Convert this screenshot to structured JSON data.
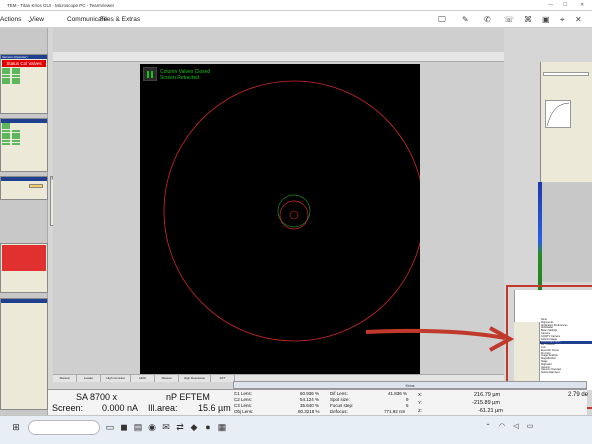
{
  "window": {
    "title": "TEM - Titan Krios GUI - Microscope PC - TeamViewer"
  },
  "teamviewer_menu": {
    "actions": "Actions",
    "view": "View",
    "communicate": "Communicate",
    "files_extras": "Files & Extras"
  },
  "vacuum": {
    "header": "Vacuum (Operator)",
    "button": "Status Col Valves"
  },
  "overlay": {
    "line1": "Column Valves Closed",
    "line2": "Screen Retracted"
  },
  "options_dialog": {
    "title": "Options"
  },
  "bottom_tabs": [
    "Manual",
    "Loader",
    "High Contrast",
    "HDR",
    "Manual",
    "High Resolution",
    "DFT"
  ],
  "instrument": "Krios",
  "status": {
    "magnification": "SA 8700 x",
    "mode": "nP EFTEM",
    "screen_label": "Screen:",
    "screen_current": "0.000 nA",
    "ill_area_label": "Ill.area:",
    "ill_area_value": "15.6 µm",
    "lens_labels": [
      "C1 Lens:",
      "C2 Lens:",
      "C3 Lens:",
      "Obj Lens:"
    ],
    "lens_values": [
      "60.936 %",
      "54.124 %",
      "35.640 %",
      "80.3218 %"
    ],
    "misc_labels": [
      "Dif Lens:",
      "Spot size:",
      "Focus step:",
      "Defocus:"
    ],
    "misc_values": [
      "41.836 %",
      "9",
      "5",
      "771.92 nm"
    ],
    "axis_labels": [
      "X:",
      "Y:",
      "Z:"
    ],
    "axis_values": [
      "216.79 µm",
      "-215.89 µm",
      "-61.21 µm"
    ],
    "tilt_value": "2.79 de"
  },
  "dropdown_items": [
    "None",
    "Alignments",
    "Application Preferences",
    "Autoloader",
    "Beam Settings",
    "Camera",
    "CCD/TV Camera",
    "Column Stage",
    "Direct Alignments",
    "DFT Control",
    "Gun",
    "Eucentric Focus",
    "Flu Cam",
    "Image Settings",
    "Magnification",
    "Stage",
    "Stigmator",
    "Vacuum",
    "Vacuum Overview",
    "Select Alignment"
  ],
  "dropdown_selected_index": 8,
  "colors": {
    "vacuum_red": "#e00000",
    "overlay_green": "#19c419",
    "ring_red": "#d02828",
    "annotation_red": "#c0392b"
  }
}
